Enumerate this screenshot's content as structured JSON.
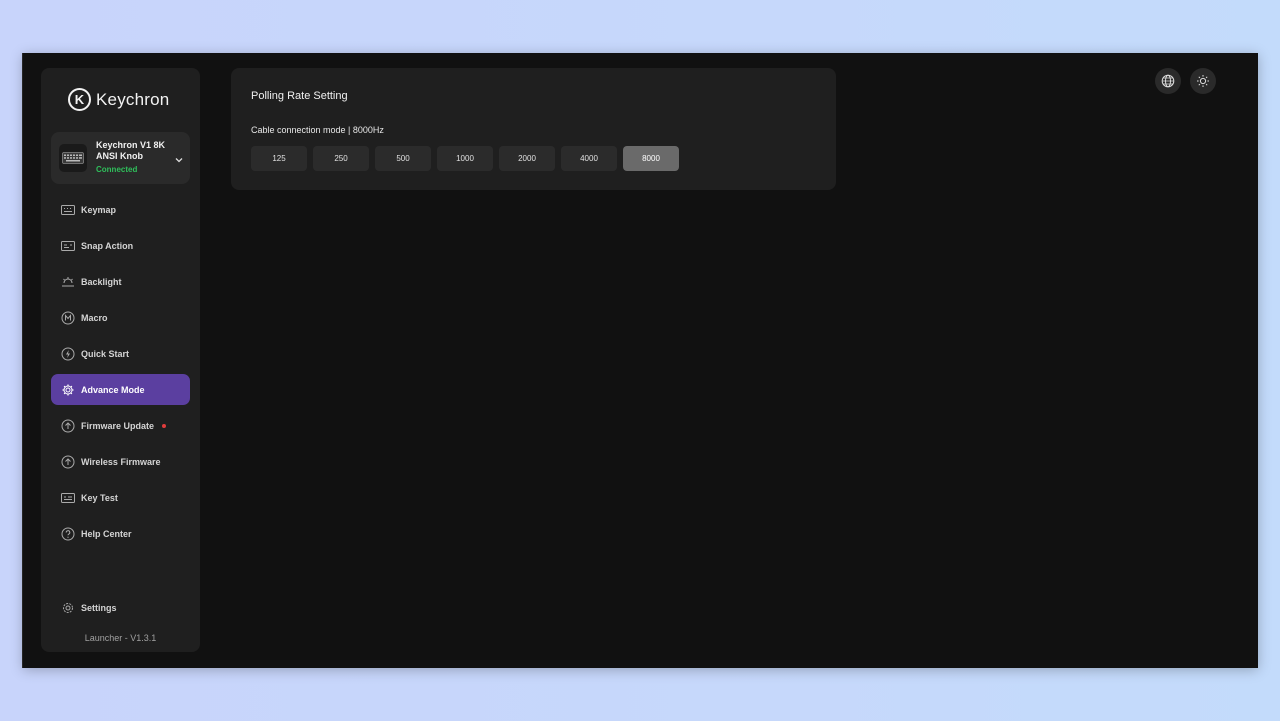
{
  "app": {
    "brand": "Keychron",
    "logo_letter": "K"
  },
  "device": {
    "name": "Keychron V1 8K ANSI Knob",
    "status": "Connected"
  },
  "nav": [
    {
      "label": "Keymap",
      "icon": "keyboard-icon"
    },
    {
      "label": "Snap Action",
      "icon": "snap-action-icon"
    },
    {
      "label": "Backlight",
      "icon": "backlight-icon"
    },
    {
      "label": "Macro",
      "icon": "macro-icon"
    },
    {
      "label": "Quick Start",
      "icon": "lightning-icon"
    },
    {
      "label": "Advance Mode",
      "icon": "gear-icon",
      "active": true
    },
    {
      "label": "Firmware Update",
      "icon": "upload-icon",
      "badge": true
    },
    {
      "label": "Wireless Firmware",
      "icon": "upload-icon"
    },
    {
      "label": "Key Test",
      "icon": "key-test-icon"
    },
    {
      "label": "Help Center",
      "icon": "help-icon"
    }
  ],
  "settings_label": "Settings",
  "version": "Launcher - V1.3.1",
  "polling": {
    "title": "Polling Rate Setting",
    "subtitle": "Cable connection mode | 8000Hz",
    "rates": [
      "125",
      "250",
      "500",
      "1000",
      "2000",
      "4000",
      "8000"
    ],
    "selected": "8000"
  },
  "colors": {
    "accent": "#5b3fa0",
    "connected": "#2fbf5b",
    "badge": "#e03c3c"
  },
  "top_icons": [
    "globe-icon",
    "sun-icon"
  ]
}
